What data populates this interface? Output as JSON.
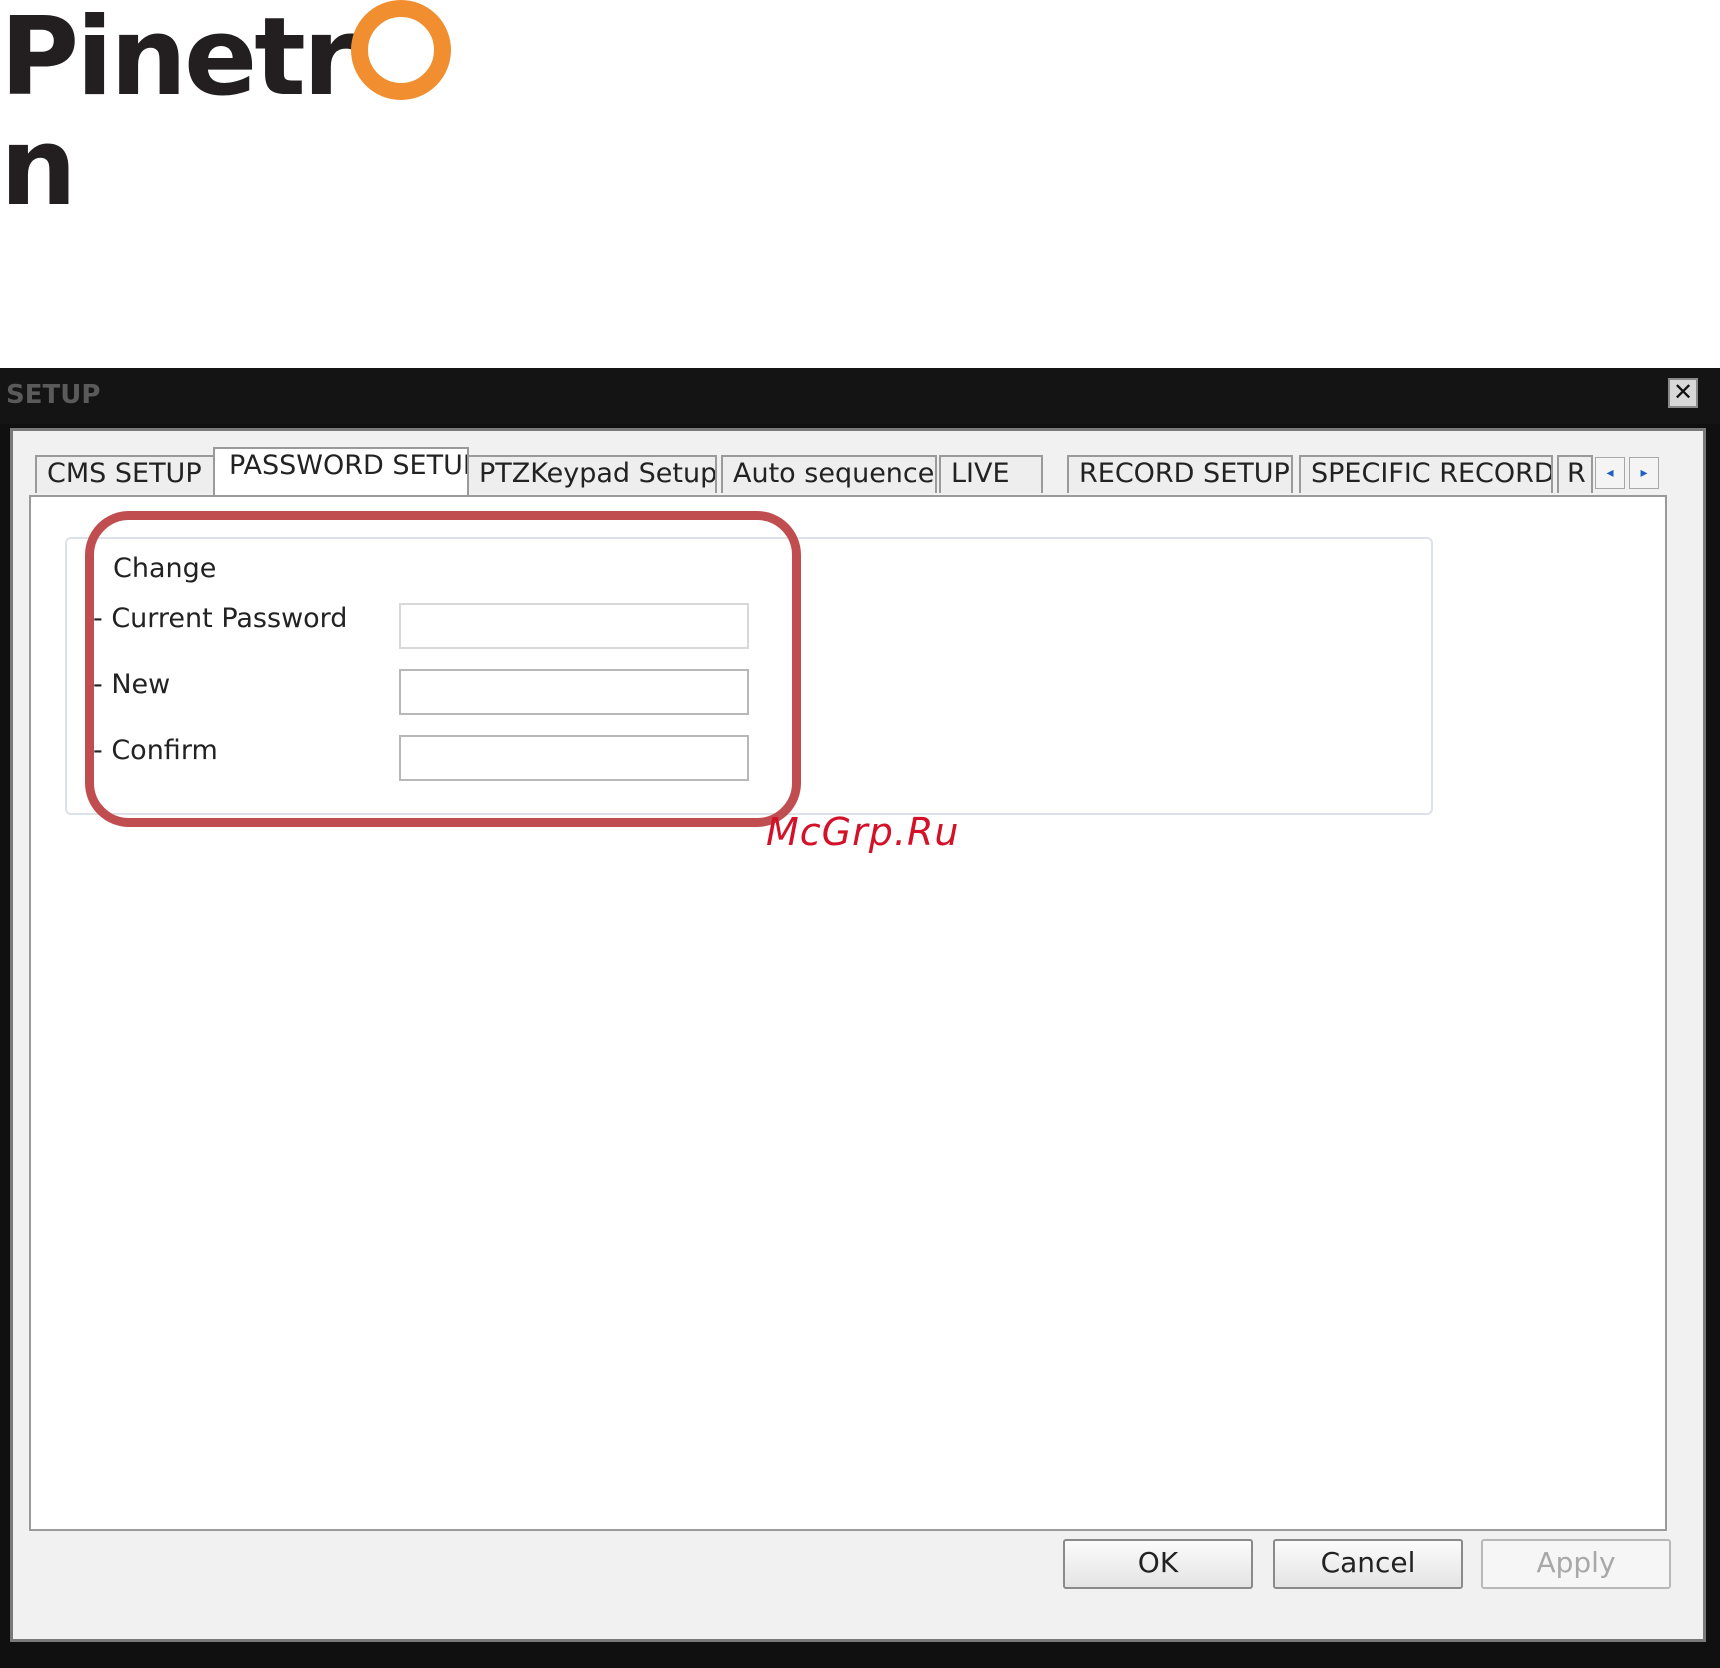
{
  "logo": {
    "text_before": "Pinetr",
    "text_after": "n",
    "accent_color": "#f18e2f"
  },
  "window": {
    "title": "SETUP",
    "close_icon": "close-icon"
  },
  "tabs": [
    {
      "label": "CMS SETUP",
      "active": false
    },
    {
      "label": "PASSWORD SETUP",
      "active": true
    },
    {
      "label": "PTZKeypad Setup",
      "active": false
    },
    {
      "label": "Auto sequence",
      "active": false
    },
    {
      "label": "LIVE",
      "active": false
    },
    {
      "label": "RECORD SETUP",
      "active": false
    },
    {
      "label": "SPECIFIC RECORD",
      "active": false
    },
    {
      "label": "R",
      "active": false
    }
  ],
  "tab_scroll": {
    "left": "◂",
    "right": "▸"
  },
  "password": {
    "group_title": "Change",
    "current_label": "- Current Password",
    "new_label": "- New",
    "confirm_label": "- Confirm",
    "current_value": "",
    "new_value": "",
    "confirm_value": ""
  },
  "highlight_color": "#c04e50",
  "buttons": {
    "ok": "OK",
    "cancel": "Cancel",
    "apply": "Apply"
  },
  "watermark": "McGrp.Ru"
}
